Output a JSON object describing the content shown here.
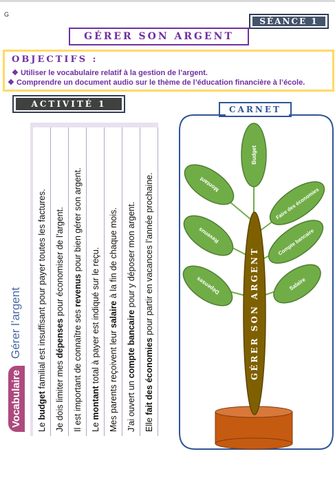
{
  "cursor_text": "G",
  "seance": "SÉANCE 1",
  "title": "GÉRER SON ARGENT",
  "objectifs": {
    "title": "OBJECTIFS :",
    "items": [
      "Utiliser le vocabulaire relatif à la gestion de l’argent.",
      "Comprendre un document audio sur le thème de l’éducation financière à l’école."
    ]
  },
  "activite": "ACTIVITÉ 1",
  "carnet": "CARNET",
  "vocab": {
    "tag": "Vocabulaire",
    "heading": "Gérer l’argent",
    "sentences": [
      {
        "before": "Elle ",
        "term": "fait des économies",
        "after": " pour partir en vacances l’année prochaine."
      },
      {
        "before": "J’ai ouvert un ",
        "term": "compte bancaire",
        "after": " pour y déposer mon argent."
      },
      {
        "before": "Mes parents reçoivent leur ",
        "term": "salaire",
        "after": " à la fin de chaque mois."
      },
      {
        "before": "Le ",
        "term": "montant",
        "after": " total à payer est indiqué sur le reçu."
      },
      {
        "before": "Il est important de connaître ses ",
        "term": "revenus",
        "after": " pour bien gérer son argent."
      },
      {
        "before": "Je dois limiter mes ",
        "term": "dépenses",
        "after": " pour économiser de l’argent."
      },
      {
        "before": "Le ",
        "term": "budget",
        "after": " familial est insuffisant pour payer toutes les factures."
      }
    ]
  },
  "tree": {
    "trunk": "GÉRER SON ARGENT",
    "leaves": [
      "Budget",
      "Montant",
      "Faire des économies",
      "Revenus",
      "Compte bancaire",
      "Dépenses",
      "Salaire"
    ],
    "colors": {
      "leaf": "#70ad47",
      "leaf_border": "#507e32",
      "trunk": "#7f6000",
      "pot": "#c55a11",
      "frame": "#2f5597",
      "branch": "#70ad47"
    }
  }
}
